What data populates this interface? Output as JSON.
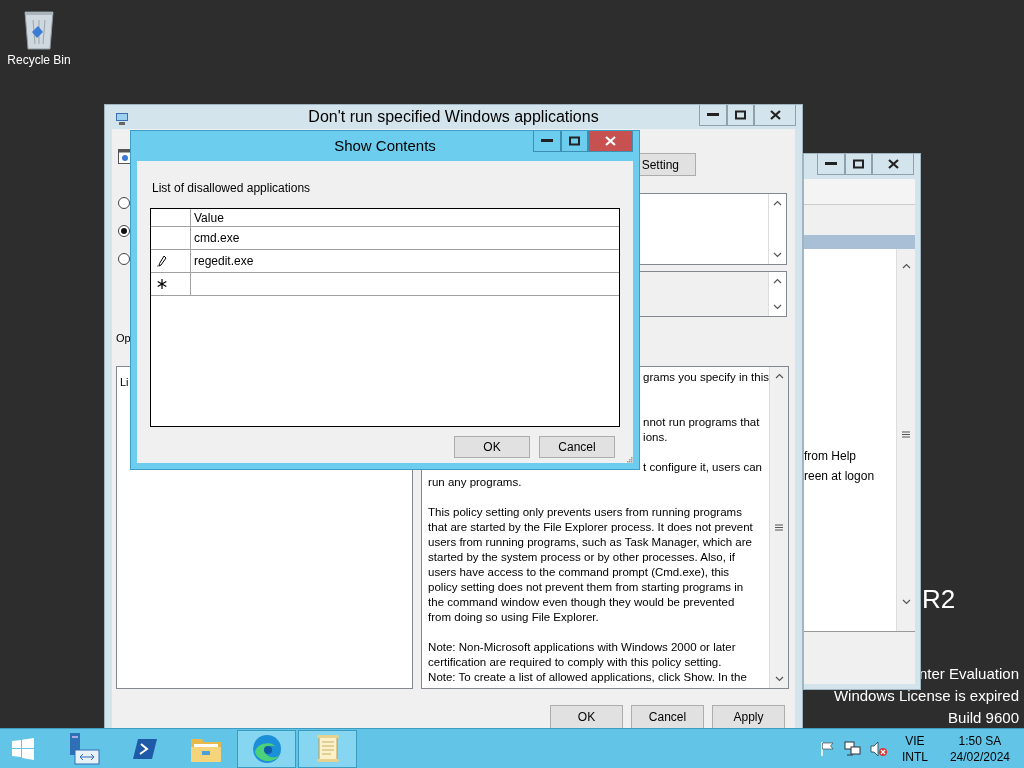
{
  "desktop": {
    "icons": [
      {
        "label": "Recycle Bin"
      }
    ],
    "edition": "R2",
    "license_lines": [
      "nter Evaluation",
      "Windows License is expired",
      "Build 9600"
    ]
  },
  "background_window": {
    "items": [
      "from Help",
      "reen at logon"
    ]
  },
  "policy_window": {
    "title": "Don't run specified Windows applications",
    "setting_button": "Setting",
    "radios": [
      {
        "selected": false
      },
      {
        "selected": true
      },
      {
        "selected": false
      }
    ],
    "options_label": "Op",
    "list_label": "Li",
    "help_paragraphs": [
      {
        "lines": [
          {
            "kind": "cut",
            "text": "grams you specify in this"
          }
        ]
      },
      {
        "lines": [
          {
            "kind": "cut",
            "text": "nnot run programs that"
          },
          {
            "kind": "cut",
            "text": "ions."
          }
        ]
      },
      {
        "lines": [
          {
            "kind": "cut",
            "text": "t configure it, users can"
          },
          {
            "kind": "full",
            "text": "run any programs."
          }
        ]
      },
      {
        "lines": [
          {
            "kind": "full",
            "text": "This policy setting only prevents users from running programs"
          },
          {
            "kind": "full",
            "text": "that are started by the File Explorer process. It does not prevent"
          },
          {
            "kind": "full",
            "text": "users from running programs, such as Task Manager, which are"
          },
          {
            "kind": "full",
            "text": "started by the system process or by other processes.  Also, if"
          },
          {
            "kind": "full",
            "text": "users have access to the command prompt (Cmd.exe), this"
          },
          {
            "kind": "full",
            "text": "policy setting does not prevent them from starting programs in"
          },
          {
            "kind": "full",
            "text": "the command window even though they would be prevented"
          },
          {
            "kind": "full",
            "text": "from doing so using File Explorer."
          }
        ]
      },
      {
        "lines": [
          {
            "kind": "full",
            "text": "Note: Non-Microsoft applications with Windows 2000 or later"
          },
          {
            "kind": "full",
            "text": "certification are required to comply with this policy setting."
          },
          {
            "kind": "full",
            "text": "Note: To create a list of allowed applications, click Show.  In the"
          }
        ]
      }
    ],
    "buttons": [
      "OK",
      "Cancel",
      "Apply"
    ]
  },
  "show_contents": {
    "title": "Show Contents",
    "label": "List of disallowed applications",
    "column": "Value",
    "rows": [
      {
        "kind": "entry",
        "value": "cmd.exe",
        "editing": false
      },
      {
        "kind": "entry",
        "value": "regedit.exe",
        "editing": true
      },
      {
        "kind": "new"
      }
    ],
    "buttons": [
      "OK",
      "Cancel"
    ]
  },
  "taskbar": {
    "apps": [
      {
        "kind": "start",
        "running": false
      },
      {
        "kind": "server",
        "running": false
      },
      {
        "kind": "shell",
        "running": false
      },
      {
        "kind": "folder",
        "running": false
      },
      {
        "kind": "browser",
        "running": true
      },
      {
        "kind": "notes",
        "running": true
      }
    ],
    "tray": {
      "language": "VIE",
      "layout": "INTL",
      "time": "1:50 SA",
      "date": "24/02/2024"
    }
  }
}
